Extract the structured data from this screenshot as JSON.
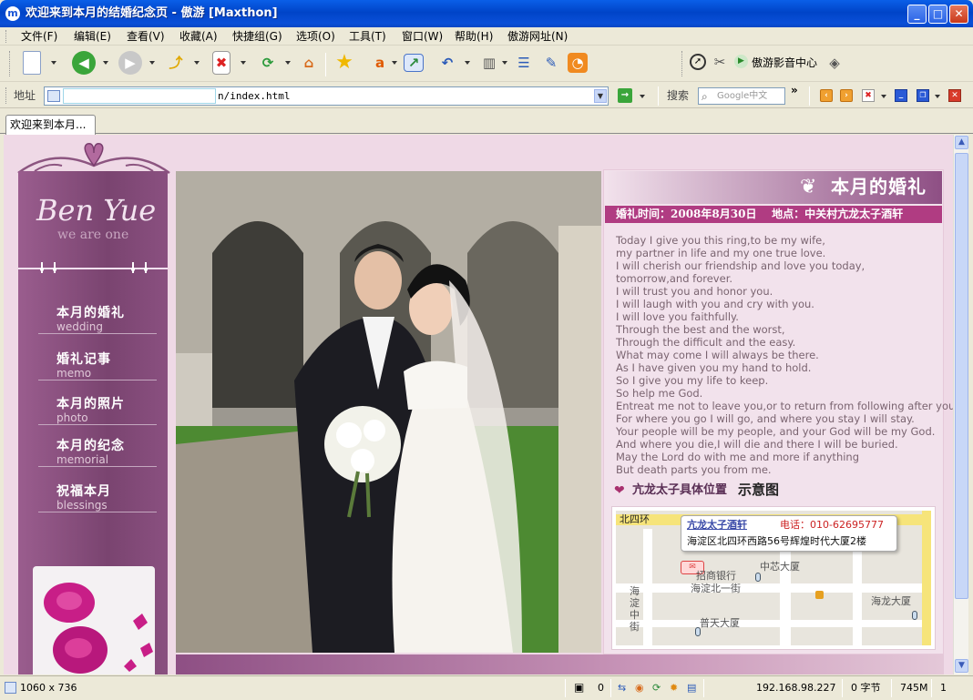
{
  "window": {
    "title": "欢迎来到本月的结婚纪念页 - 傲游 [Maxthon]",
    "app_icon": "m",
    "minimize": "_",
    "maximize": "□",
    "close": "✕"
  },
  "menu": [
    "文件(F)",
    "编辑(E)",
    "查看(V)",
    "收藏(A)",
    "快捷组(G)",
    "选项(O)",
    "工具(T)",
    "窗口(W)",
    "帮助(H)",
    "傲游网址(N)"
  ],
  "toolbar": {
    "media_center": "傲游影音中心"
  },
  "address": {
    "label": "地址",
    "value": "n/index.html",
    "search_label": "搜索",
    "search_placeholder": "Google中文",
    "more": "»"
  },
  "tab": {
    "title": "欢迎来到本月..."
  },
  "site": {
    "logo_main": "Ben Yue",
    "logo_sub": "we are one",
    "nav": [
      {
        "zh": "本月的婚礼",
        "en": "wedding"
      },
      {
        "zh": "婚礼记事",
        "en": "memo"
      },
      {
        "zh": "本月的照片",
        "en": "photo"
      },
      {
        "zh": "本月的纪念",
        "en": "memorial"
      },
      {
        "zh": "祝福本月",
        "en": "blessings"
      }
    ],
    "heading": "本月的婚礼",
    "info_line": "婚礼时间：2008年8月30日    地点：中关村亢龙太子酒轩",
    "poem": [
      "Today I give you this ring,to be my wife,",
      "my partner in life and my one true love.",
      "I will cherish our friendship and love you today,",
      "tomorrow,and forever.",
      "I will trust you and honor you.",
      "I will laugh with you and cry with you.",
      "I will love you faithfully.",
      "Through the best and the worst,",
      "Through the difficult and the easy.",
      "What may come I will always be there.",
      "As I have given you my hand to hold.",
      "So I give you my life to keep.",
      "So help me God.",
      "Entreat me not to leave you,or to return from following after you,",
      "For where you go I will go,  and where you stay I will stay.",
      "Your people will be my people,  and your God will be my God.",
      "And where you die,I will die and there I will be buried.",
      "May the Lord do with me and more if anything",
      "But death parts you from me."
    ],
    "map_title_a": "亢龙太子具体位置",
    "map_title_b": "示意图",
    "map": {
      "ring_road": "北四环",
      "hotel": "亢龙太子酒轩",
      "phone": "电话：010-62695777",
      "address": "海淀区北四环西路56号辉煌时代大厦2楼",
      "bank": "招商银行",
      "street1": "海淀北一街",
      "zhongxin": "中芯大厦",
      "haidian_st": "海淀中街",
      "haidian_st_chars": [
        "海",
        "淀",
        "中",
        "街"
      ],
      "putian": "普天大厦",
      "hailong": "海龙大厦"
    }
  },
  "status": {
    "size": "1060 x 736",
    "count": "0",
    "ip": "192.168.98.227",
    "bytes": "0 字节",
    "mem": "745M",
    "num": "1"
  }
}
